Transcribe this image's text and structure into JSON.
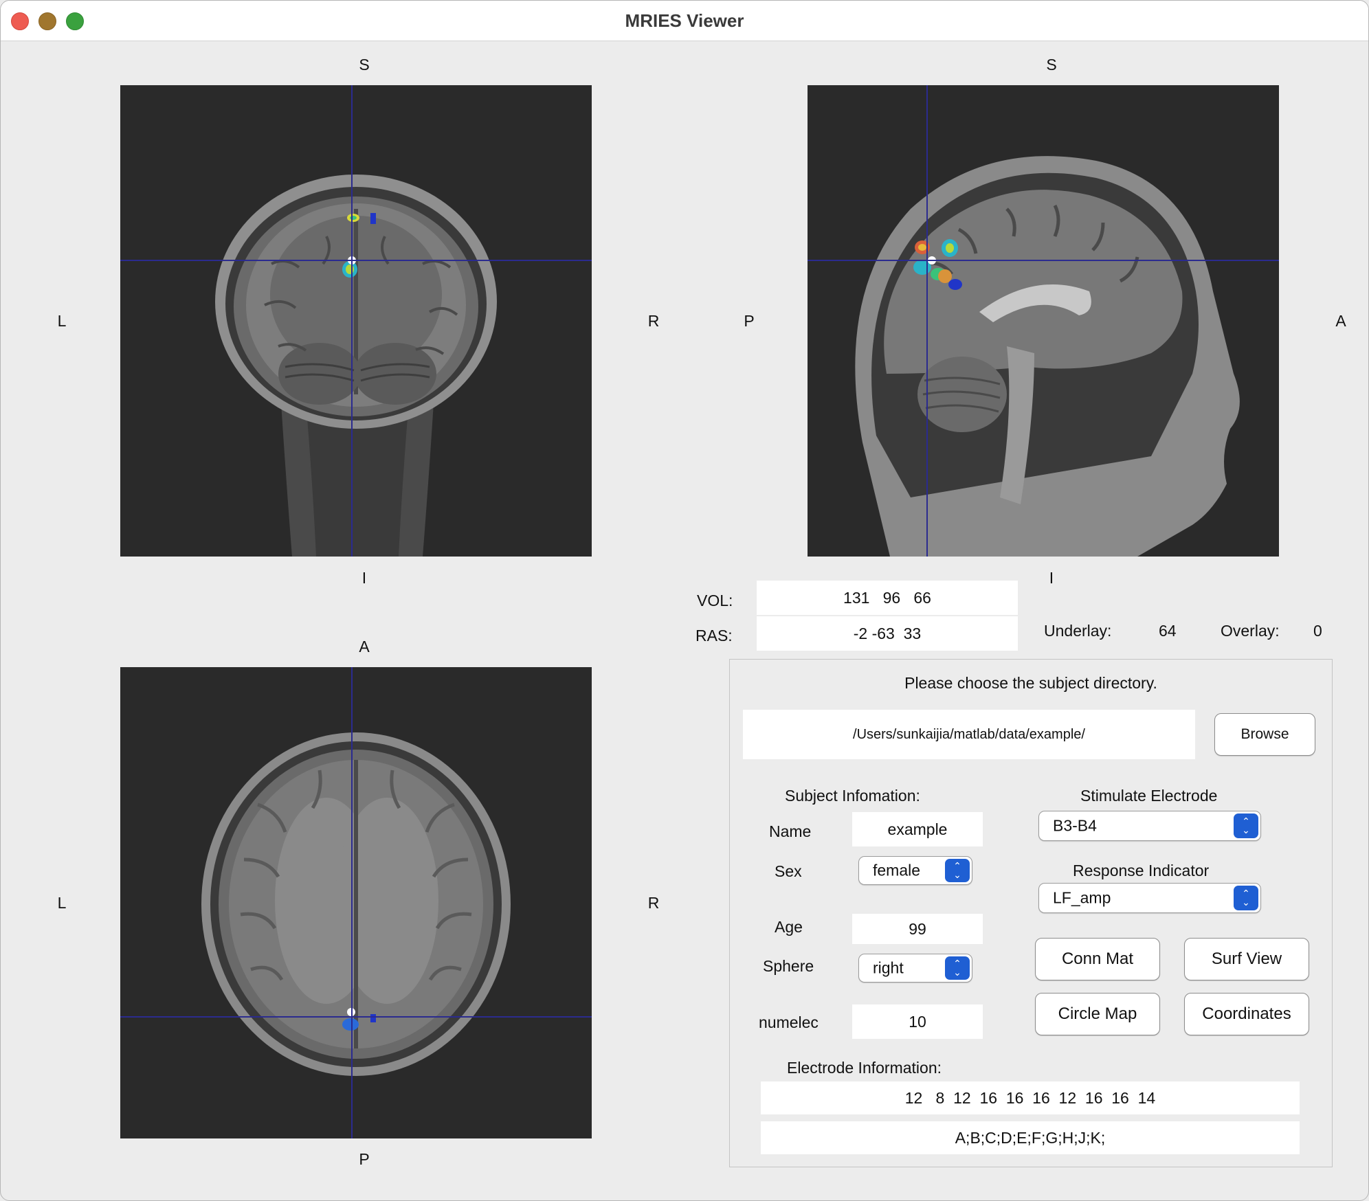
{
  "window": {
    "title": "MRIES Viewer"
  },
  "orientation": {
    "coronal": {
      "top": "S",
      "bottom": "I",
      "left": "L",
      "right": "R"
    },
    "sagittal": {
      "top": "S",
      "bottom": "I",
      "left": "P",
      "right": "A"
    },
    "axial": {
      "top": "A",
      "bottom": "P",
      "left": "L",
      "right": "R"
    }
  },
  "coords": {
    "vol_label": "VOL:",
    "vol_value": "131   96   66",
    "ras_label": "RAS:",
    "ras_value": "-2 -63  33"
  },
  "intensity": {
    "underlay_label": "Underlay:",
    "underlay_value": "64",
    "overlay_label": "Overlay:",
    "overlay_value": "0"
  },
  "panel": {
    "prompt": "Please choose the subject directory.",
    "directory": "/Users/sunkaijia/matlab/data/example/",
    "browse_label": "Browse",
    "subject_header": "Subject Infomation:",
    "name_label": "Name",
    "name_value": "example",
    "sex_label": "Sex",
    "sex_value": "female",
    "age_label": "Age",
    "age_value": "99",
    "sphere_label": "Sphere",
    "sphere_value": "right",
    "numelec_label": "numelec",
    "numelec_value": "10",
    "stim_header": "Stimulate Electrode",
    "stim_value": "B3-B4",
    "response_header": "Response Indicator",
    "response_value": "LF_amp",
    "conn_mat_label": "Conn Mat",
    "surf_view_label": "Surf View",
    "circle_map_label": "Circle Map",
    "coordinates_label": "Coordinates",
    "electrode_header": "Electrode Information:",
    "electrode_counts": "12   8  12  16  16  16  12  16  16  14",
    "electrode_names": "A;B;C;D;E;F;G;H;J;K;"
  },
  "colors": {
    "crosshair": "#2b2b8f",
    "background": "#2a2a2a",
    "accent": "#1f5fd3"
  }
}
